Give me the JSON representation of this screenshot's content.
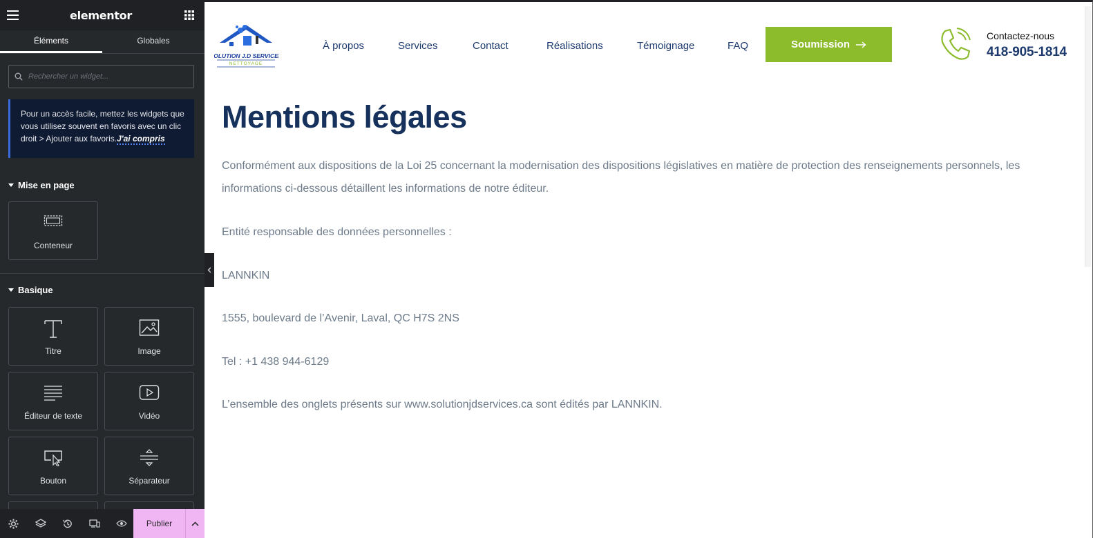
{
  "editor": {
    "logo": "elementor",
    "tabs": [
      "Éléments",
      "Globales"
    ],
    "search_placeholder": "Rechercher un widget...",
    "notice_text": "Pour un accès facile, mettez les widgets que vous utilisez souvent en favoris avec un clic droit > Ajouter aux favoris.",
    "notice_link": "J'ai compris",
    "categories": {
      "layout": {
        "label": "Mise en page",
        "widgets": [
          "Conteneur"
        ]
      },
      "basic": {
        "label": "Basique",
        "widgets": [
          "Titre",
          "Image",
          "Éditeur de texte",
          "Vidéo",
          "Bouton",
          "Séparateur"
        ]
      }
    },
    "publish_label": "Publier",
    "bottom_icons": [
      "settings-icon",
      "layers-icon",
      "history-icon",
      "responsive-icon",
      "preview-eye-icon"
    ]
  },
  "site": {
    "logo_text": "SOLUTION J.D SERVICES",
    "logo_subtext": "NETTOYAGE",
    "nav": [
      "À propos",
      "Services",
      "Contact",
      "Réalisations",
      "Témoignage",
      "FAQ"
    ],
    "cta_label": "Soumission",
    "contact_label": "Contactez-nous",
    "contact_phone": "418-905-1814",
    "colors": {
      "navy": "#1c3a6e",
      "green": "#8cbb2c",
      "body_text": "#6c7a89"
    }
  },
  "page": {
    "title": "Mentions légales",
    "intro": "Conformément aux dispositions de la Loi 25 concernant la modernisation des dispositions législatives en matière de protection des renseignements personnels, les informations ci-dessous détaillent les informations de notre éditeur.",
    "entity_label": "Entité responsable des données personnelles :",
    "company": "LANNKIN",
    "address": "1555, boulevard de l’Avenir, Laval, QC H7S 2NS",
    "tel": "Tel : +1 438 944-6129",
    "footer_note": "L’ensemble des onglets présents sur www.solutionjdservices.ca sont édités par LANNKIN."
  }
}
